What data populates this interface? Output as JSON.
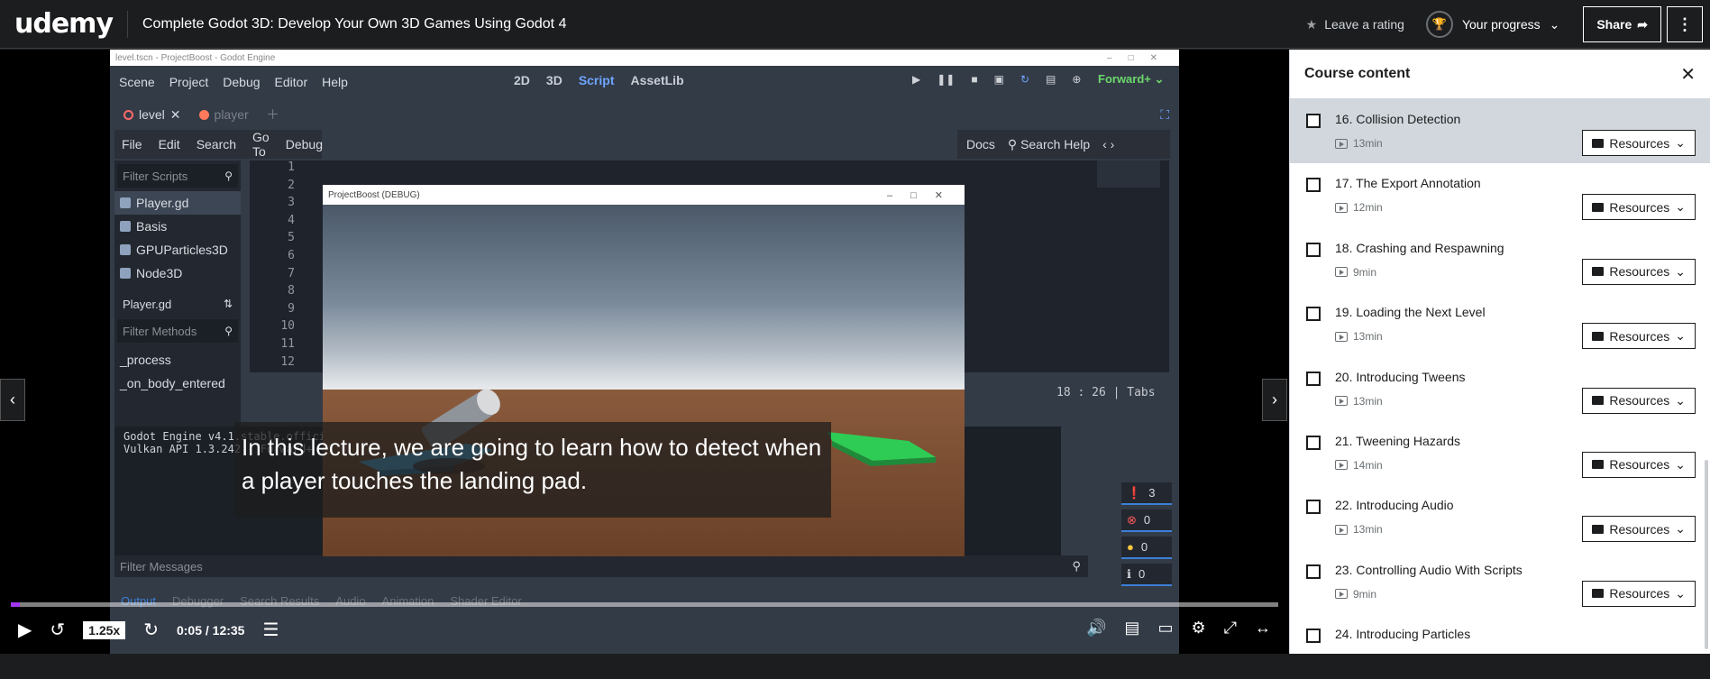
{
  "header": {
    "logo": "udemy",
    "course_title": "Complete Godot 3D: Develop Your Own 3D Games Using Godot 4",
    "leave_rating": "Leave a rating",
    "your_progress": "Your progress",
    "share": "Share"
  },
  "godot": {
    "window_title": "level.tscn - ProjectBoost - Godot Engine",
    "menus": [
      "Scene",
      "Project",
      "Debug",
      "Editor",
      "Help"
    ],
    "workspaces": [
      "2D",
      "3D",
      "Script",
      "AssetLib"
    ],
    "renderer": "Forward+",
    "tabs": [
      "level",
      "player"
    ],
    "script_menu": [
      "File",
      "Edit",
      "Search",
      "Go To",
      "Debug"
    ],
    "docs": "Docs",
    "search_help": "Search Help",
    "filter_scripts": "Filter Scripts",
    "scripts": [
      "Player.gd",
      "Basis",
      "GPUParticles3D",
      "Node3D"
    ],
    "current_script": "Player.gd",
    "filter_methods": "Filter Methods",
    "methods": [
      "_process",
      "_on_body_entered"
    ],
    "line_numbers": [
      "1",
      "2",
      "3",
      "4",
      "5",
      "6",
      "7",
      "8",
      "9",
      "10",
      "11",
      "12"
    ],
    "cursor_status": "18 :  26 | Tabs",
    "output_lines": [
      "Godot Engine v4.1.stable.officia",
      "Vulkan API 1.3.242 - Forward+ -"
    ],
    "counts": [
      "3",
      "0",
      "0",
      "0"
    ],
    "filter_messages": "Filter Messages",
    "bottom_tabs": [
      "Output",
      "Debugger",
      "Search Results",
      "Audio",
      "Animation",
      "Shader Editor"
    ],
    "version": "4.1.stable"
  },
  "debug_window": {
    "title": "ProjectBoost (DEBUG)"
  },
  "subtitle": "In this lecture, we are going to learn how to detect when a player touches the landing pad.",
  "playback": {
    "speed": "1.25x",
    "time": "0:05 / 12:35",
    "progress_fraction": 0.007
  },
  "sidebar": {
    "title": "Course content",
    "resources_label": "Resources",
    "lectures": [
      {
        "title": "16. Collision Detection",
        "duration": "13min",
        "current": true
      },
      {
        "title": "17. The Export Annotation",
        "duration": "12min"
      },
      {
        "title": "18. Crashing and Respawning",
        "duration": "9min"
      },
      {
        "title": "19. Loading the Next Level",
        "duration": "13min"
      },
      {
        "title": "20. Introducing Tweens",
        "duration": "13min"
      },
      {
        "title": "21. Tweening Hazards",
        "duration": "14min"
      },
      {
        "title": "22. Introducing Audio",
        "duration": "13min"
      },
      {
        "title": "23. Controlling Audio With Scripts",
        "duration": "9min"
      },
      {
        "title": "24. Introducing Particles",
        "duration": ""
      }
    ]
  },
  "colors": {
    "brand": "#a435f0",
    "godot_bg": "#333b47",
    "landing_pad": "#2ecc55",
    "launch_pad": "#4fb3e8"
  }
}
